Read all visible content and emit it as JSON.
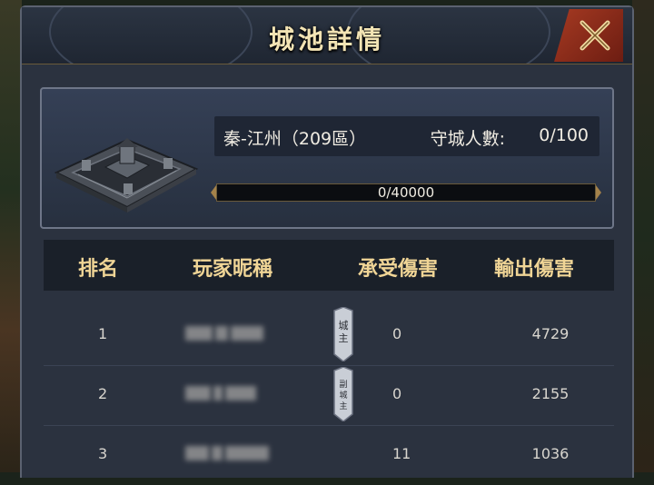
{
  "dialog": {
    "title": "城池詳情"
  },
  "city": {
    "name": "秦-江州（209區）",
    "defender_label": "守城人數:",
    "defender_count": "0/100",
    "progress_text": "0/40000",
    "progress_fraction": 0
  },
  "table": {
    "headers": {
      "rank": "排名",
      "player": "玩家昵稱",
      "damage_taken": "承受傷害",
      "damage_dealt": "輸出傷害"
    },
    "rows": [
      {
        "rank": "1",
        "badge": "城主",
        "damage_taken": "0",
        "damage_dealt": "4729"
      },
      {
        "rank": "2",
        "badge": "副城主",
        "damage_taken": "0",
        "damage_dealt": "2155"
      },
      {
        "rank": "3",
        "badge": "",
        "damage_taken": "11",
        "damage_dealt": "1036"
      }
    ]
  },
  "colors": {
    "title_gold": "#f3e4b4",
    "header_gold": "#f0d596",
    "close_red": "#a63a22",
    "panel_bg": "#2b323f"
  },
  "icons": {
    "close": "close-x-icon",
    "castle": "castle-model-icon",
    "rank_badge": "tag-badge-icon"
  }
}
